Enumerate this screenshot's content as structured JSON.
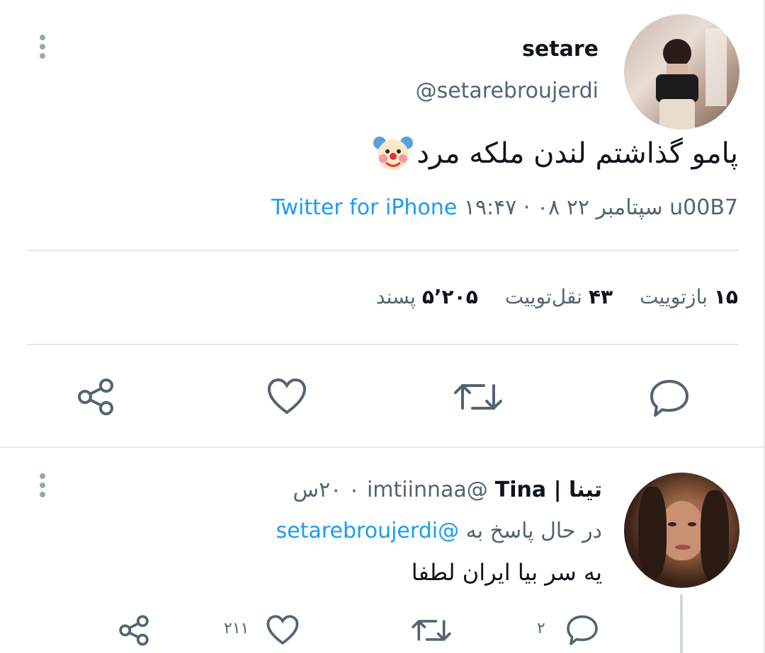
{
  "main_tweet": {
    "display_name": "setare",
    "handle": "@setarebroujerdi",
    "text": "پامو گذاشتم لندن ملکه مرد",
    "emoji_icon": "clown-face-icon",
    "timestamp": "۱۹:۴۷ · ۰۸ سپتامبر ۲۲ u00B7",
    "source": "Twitter for iPhone",
    "stats": {
      "retweets_count": "۱۵",
      "retweets_label": "بازتوییت",
      "quotes_count": "۴۳",
      "quotes_label": "نقل‌توییت",
      "likes_count": "۵٬۲۰۵",
      "likes_label": "پسند"
    },
    "actions": [
      "reply-icon",
      "retweet-icon",
      "like-icon",
      "share-icon"
    ]
  },
  "reply": {
    "display_name": "تینا | Tina",
    "handle": "@imtiinnaa",
    "time": "۰ ۲۰س",
    "replying_to_label": "در حال پاسخ به",
    "replying_to_handle": "@setarebroujerdi",
    "text": "یه سر بیا ایران لطفا",
    "reply_count": "۲",
    "like_count": "۲۱۱"
  },
  "colors": {
    "accent": "#1d9bf0",
    "secondary_text": "#536471",
    "divider": "#e3e7ea"
  }
}
